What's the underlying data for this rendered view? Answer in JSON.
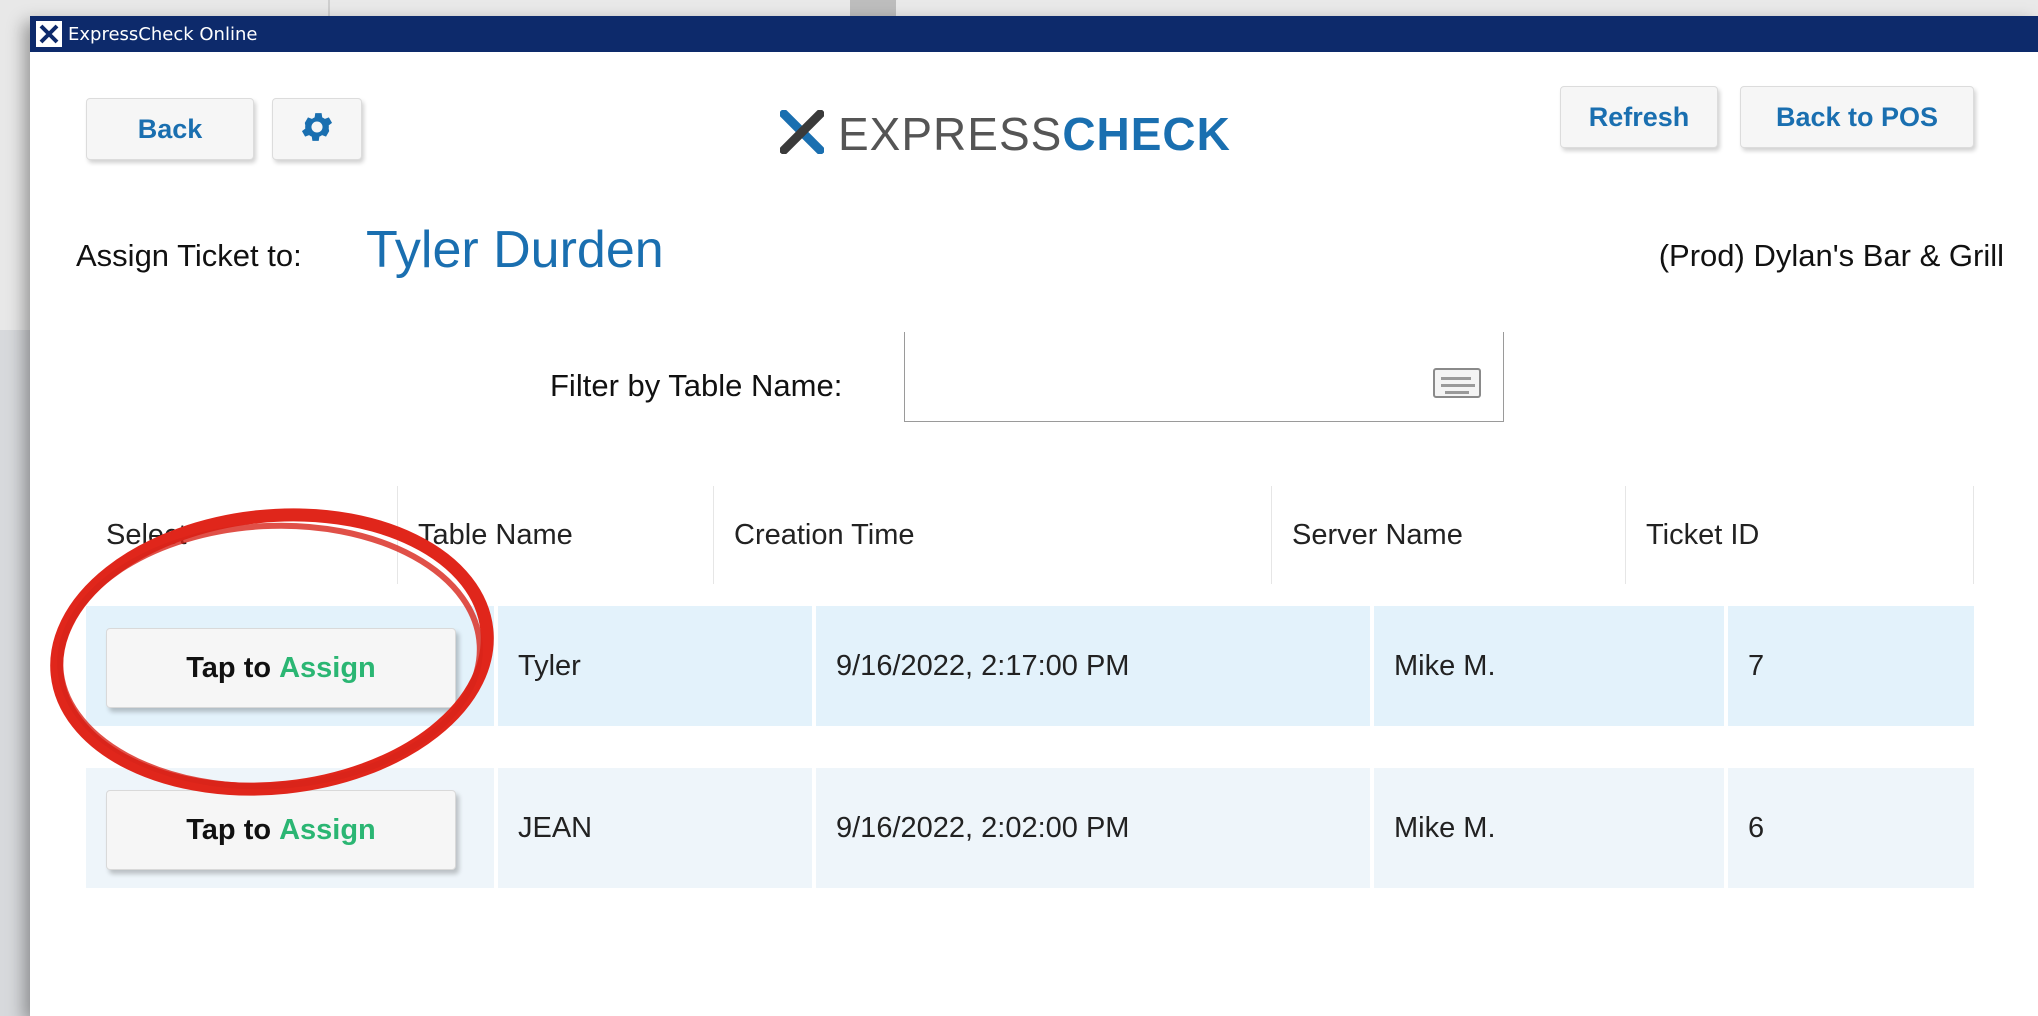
{
  "window": {
    "title": "ExpressCheck Online"
  },
  "toolbar": {
    "back_label": "Back",
    "settings_icon": "gear-icon",
    "refresh_label": "Refresh",
    "back_to_pos_label": "Back to POS"
  },
  "logo": {
    "light": "EXPRESS",
    "bold": "CHECK"
  },
  "assign": {
    "label": "Assign Ticket to:",
    "name": "Tyler Durden"
  },
  "venue": "(Prod) Dylan's Bar & Grill",
  "filter": {
    "label": "Filter by Table Name:",
    "value": "",
    "keyboard_icon": "keyboard-icon"
  },
  "table": {
    "headers": [
      "Select",
      "Table Name",
      "Creation Time",
      "Server Name",
      "Ticket ID"
    ],
    "rows": [
      {
        "button_prefix": "Tap to",
        "button_accent": "Assign",
        "table_name": "Tyler",
        "creation_time": "9/16/2022, 2:17:00 PM",
        "server_name": "Mike M.",
        "ticket_id": "7"
      },
      {
        "button_prefix": "Tap to",
        "button_accent": "Assign",
        "table_name": "JEAN",
        "creation_time": "9/16/2022, 2:02:00 PM",
        "server_name": "Mike M.",
        "ticket_id": "6"
      }
    ]
  },
  "colors": {
    "accent_blue": "#1a6fb0",
    "assign_green": "#2bb673",
    "titlebar": "#0d2a6b",
    "highlight_circle": "#e0261b"
  }
}
